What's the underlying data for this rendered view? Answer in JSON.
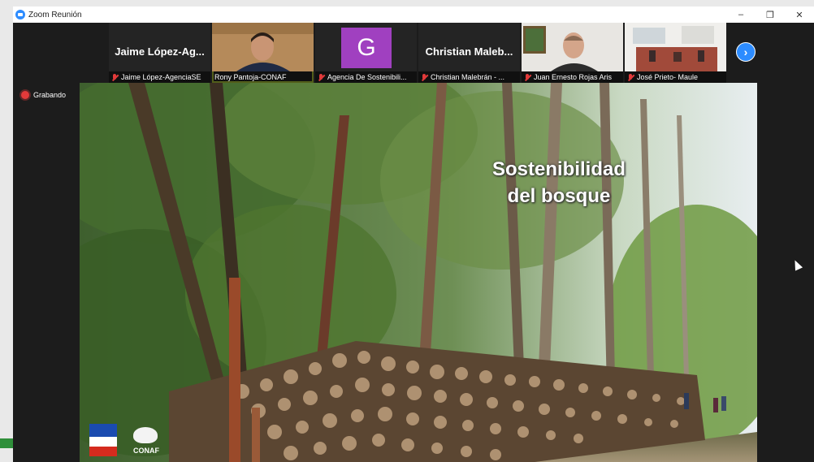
{
  "window": {
    "title": "Zoom Reunión",
    "controls": [
      "minimize-icon",
      "restore-icon",
      "close-icon"
    ]
  },
  "participants": [
    {
      "display_name": "Jaime  López-Ag...",
      "label": "Jaime López-AgenciaSE",
      "muted": true,
      "video": false
    },
    {
      "display_name": "",
      "label": "Rony Pantoja-CONAF",
      "muted": false,
      "video": true,
      "active_speaker": true
    },
    {
      "display_name": "",
      "avatar_letter": "G",
      "label": "Agencia De Sostenibili...",
      "muted": true,
      "video": false,
      "avatar_color": "#a040c0"
    },
    {
      "display_name": "Christian  Maleb...",
      "label": "Christian Malebrán - ...",
      "muted": true,
      "video": false
    },
    {
      "display_name": "",
      "label": "Juan Ernesto Rojas Aris",
      "muted": true,
      "video": true
    },
    {
      "display_name": "",
      "label": "José Prieto- Maule",
      "muted": true,
      "video": true
    }
  ],
  "recording": {
    "label": "Grabando",
    "color": "#e23a3a"
  },
  "share": {
    "slide_title_line1": "Sostenibilidad",
    "slide_title_line2": "del bosque"
  },
  "logos": {
    "conaf_text": "CONAF"
  },
  "colors": {
    "zoom_blue": "#2d8cff",
    "active_border": "#b6d13b",
    "mute_red": "#e23a3a"
  }
}
